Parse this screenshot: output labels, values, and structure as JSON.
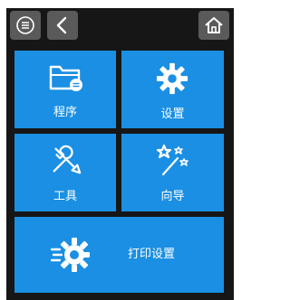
{
  "topbar": {
    "menu_icon": "menu-circle-icon",
    "back_icon": "chevron-left-icon",
    "home_icon": "home-icon"
  },
  "tiles": {
    "program": {
      "label": "程序",
      "icon": "folder-icon"
    },
    "settings": {
      "label": "设置",
      "icon": "gear-icon"
    },
    "tools": {
      "label": "工具",
      "icon": "wrench-screwdriver-icon"
    },
    "wizard": {
      "label": "向导",
      "icon": "magic-wand-icon"
    },
    "print_settings": {
      "label": "打印设置",
      "icon": "fast-gear-icon"
    }
  },
  "colors": {
    "tile": "#1a8fe3",
    "background": "#161616",
    "topbar_button": "#5a5a5a"
  }
}
